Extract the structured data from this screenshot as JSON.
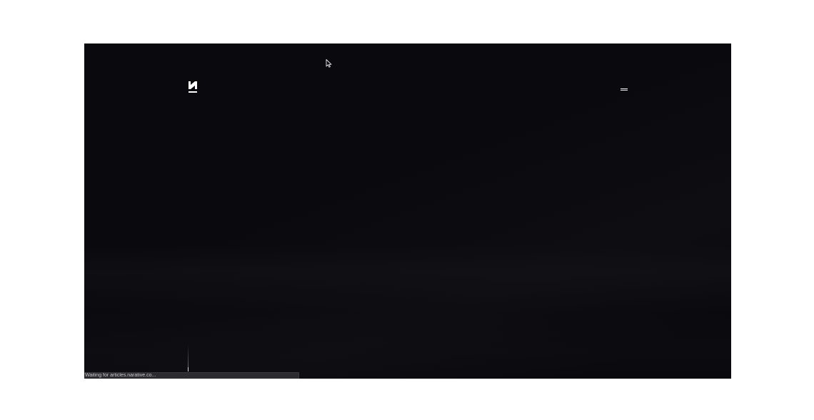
{
  "page": {
    "background_color": "#0a0a0e"
  },
  "header": {
    "logo": {
      "icon": "narative-logo-icon",
      "color": "#ffffff"
    },
    "menu": {
      "icon": "hamburger-menu-icon",
      "color": "#e8e8ea"
    }
  },
  "hero": {
    "scroll_indicator": {
      "icon": "scroll-line-indicator"
    }
  },
  "browser": {
    "status_text": "Waiting for articles.narative.co...",
    "cursor": {
      "icon": "mouse-pointer-icon"
    }
  }
}
